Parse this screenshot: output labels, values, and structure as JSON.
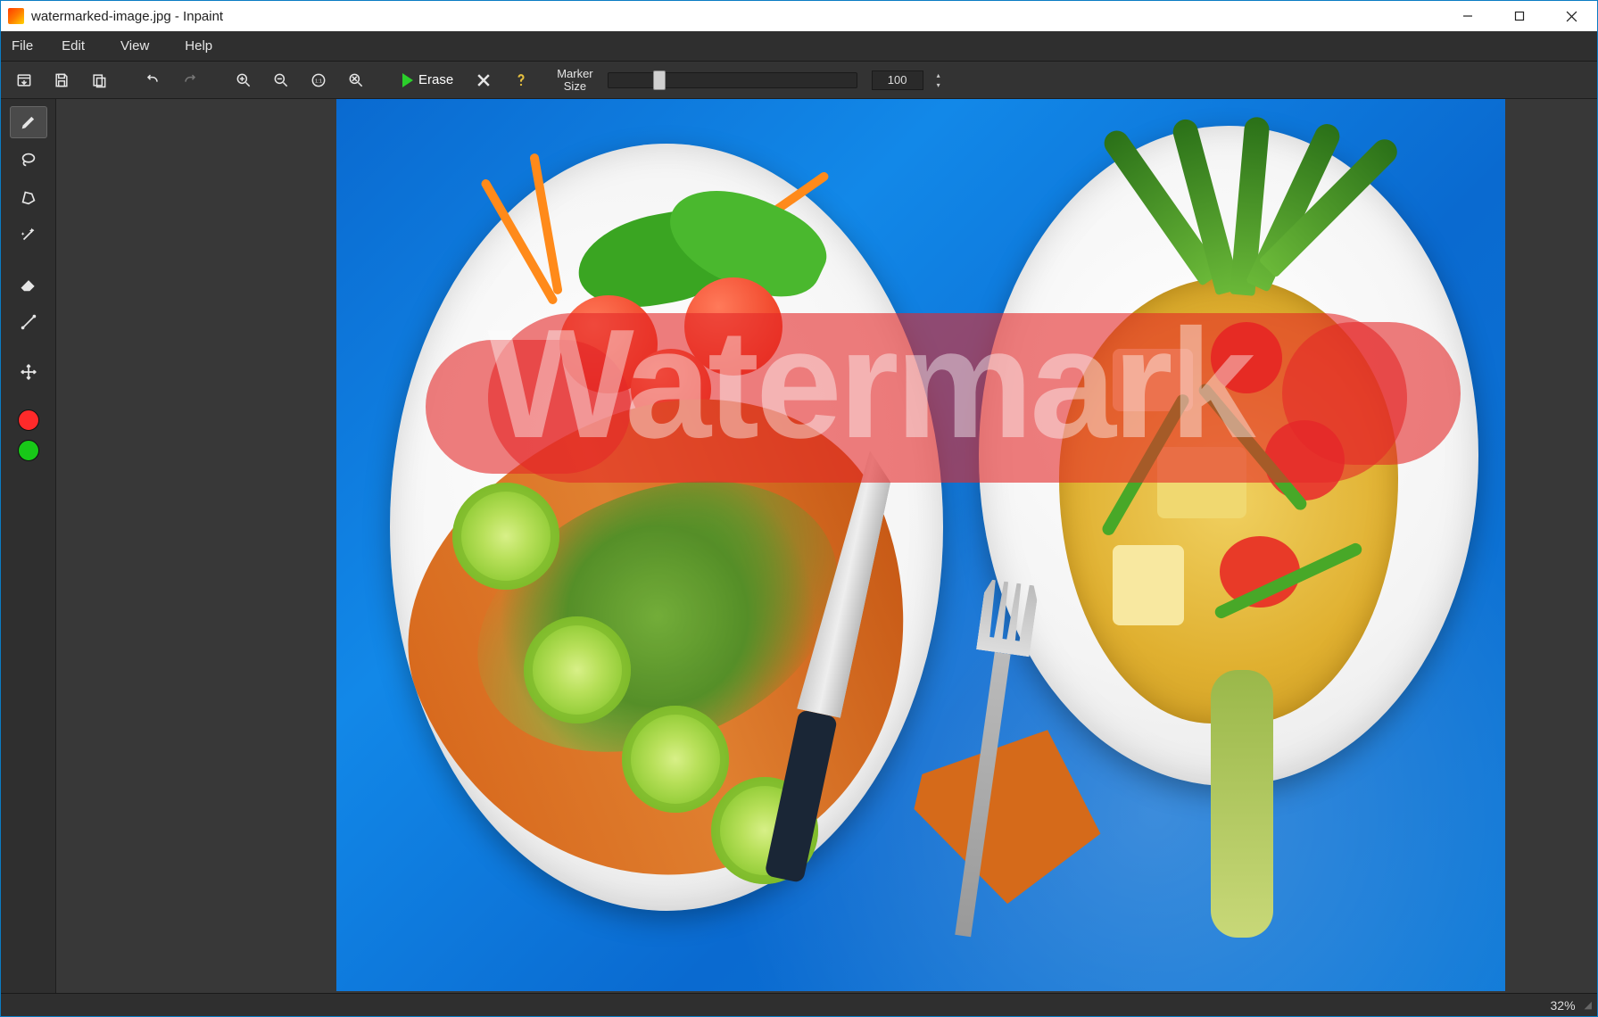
{
  "window": {
    "title": "watermarked-image.jpg - Inpaint"
  },
  "menu": {
    "file": "File",
    "edit": "Edit",
    "view": "View",
    "help": "Help"
  },
  "toolbar": {
    "erase_label": "Erase",
    "marker_size_label_line1": "Marker",
    "marker_size_label_line2": "Size",
    "marker_size_value": "100"
  },
  "canvas": {
    "watermark_text": "Watermark"
  },
  "status": {
    "zoom": "32%"
  },
  "icons": {
    "open": "open-icon",
    "save": "save-icon",
    "paste": "paste-icon",
    "undo": "undo-icon",
    "redo": "redo-icon",
    "zoom_in": "zoom-in-icon",
    "zoom_out": "zoom-out-icon",
    "zoom_actual": "zoom-actual-icon",
    "zoom_fit": "zoom-fit-icon",
    "erase": "play-icon",
    "clear": "clear-icon",
    "help": "help-icon",
    "marker": "marker-tool-icon",
    "lasso": "lasso-tool-icon",
    "polygon": "polygon-tool-icon",
    "magic": "magic-wand-icon",
    "eraser": "eraser-tool-icon",
    "line": "line-tool-icon",
    "move": "move-tool-icon"
  },
  "colors": {
    "mask_red": "#ff2a2a",
    "donor_green": "#18c818"
  }
}
